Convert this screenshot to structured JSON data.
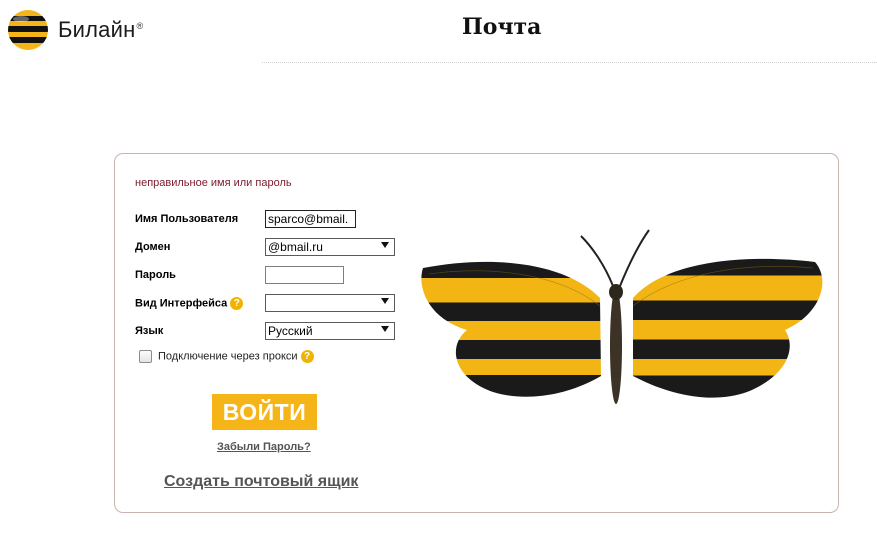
{
  "header": {
    "brand": "Билайн",
    "brand_mark": "®",
    "title": "Почта"
  },
  "form": {
    "error_message": "неправильное имя или пароль",
    "username_label": "Имя Пользователя",
    "username_value": "sparco@bmail.",
    "domain_label": "Домен",
    "domain_value": "@bmail.ru",
    "password_label": "Пароль",
    "password_value": "",
    "interface_label": "Вид Интерфейса",
    "interface_value": "",
    "language_label": "Язык",
    "language_value": "Русский",
    "proxy_label": "Подключение через прокси",
    "proxy_checked": false,
    "help_glyph": "?",
    "login_button": "ВОЙТИ",
    "forgot_link": "Забыли Пароль?",
    "create_link": "Создать почтовый ящик"
  },
  "colors": {
    "brand_yellow": "#f5b417",
    "brand_black": "#111111",
    "error_red": "#7a1a2c"
  },
  "icons": {
    "logo": "beeline-striped-circle",
    "help": "question-circle-icon",
    "dropdown": "triangle-down-icon",
    "illustration": "striped-butterfly"
  }
}
